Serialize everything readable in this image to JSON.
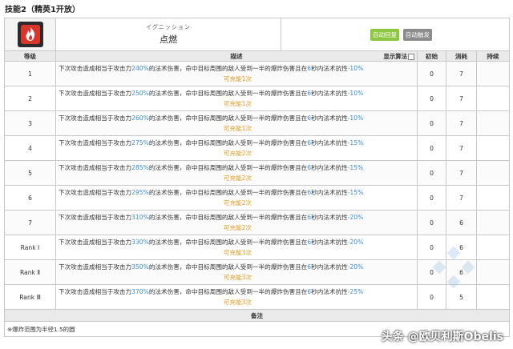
{
  "page": {
    "title": "技能2（精英1开放）"
  },
  "skill": {
    "name_jp": "イグニッション",
    "name_cn": "点燃",
    "icon": "flame-icon",
    "tags": [
      "自动回复",
      "自动触发"
    ],
    "tag_colors": [
      "#8dc63f",
      "#8c8c8c"
    ]
  },
  "columns": {
    "level": "等级",
    "description": "描述",
    "toggle": "显示算法",
    "initial": "初始",
    "cost": "消耗",
    "duration": "持续"
  },
  "levels": [
    {
      "level": "1",
      "pre": "下次攻击造成相当于攻击力",
      "pct": "240%",
      "mid": "的法术伤害，命中目标周围的敌人受到一半的爆炸伤害且在",
      "sec": "6",
      "post": "秒内法术抗性",
      "res": "-10%",
      "charges": "可充能1次",
      "initial": "0",
      "cost": "7",
      "duration": ""
    },
    {
      "level": "2",
      "pre": "下次攻击造成相当于攻击力",
      "pct": "250%",
      "mid": "的法术伤害，命中目标周围的敌人受到一半的爆炸伤害且在",
      "sec": "6",
      "post": "秒内法术抗性",
      "res": "-10%",
      "charges": "可充能1次",
      "initial": "0",
      "cost": "7",
      "duration": ""
    },
    {
      "level": "3",
      "pre": "下次攻击造成相当于攻击力",
      "pct": "260%",
      "mid": "的法术伤害，命中目标周围的敌人受到一半的爆炸伤害且在",
      "sec": "6",
      "post": "秒内法术抗性",
      "res": "-10%",
      "charges": "可充能1次",
      "initial": "0",
      "cost": "7",
      "duration": ""
    },
    {
      "level": "4",
      "pre": "下次攻击造成相当于攻击力",
      "pct": "275%",
      "mid": "的法术伤害，命中目标周围的敌人受到一半的爆炸伤害且在",
      "sec": "6",
      "post": "秒内法术抗性",
      "res": "-15%",
      "charges": "可充能2次",
      "initial": "0",
      "cost": "7",
      "duration": ""
    },
    {
      "level": "5",
      "pre": "下次攻击造成相当于攻击力",
      "pct": "285%",
      "mid": "的法术伤害，命中目标周围的敌人受到一半的爆炸伤害且在",
      "sec": "6",
      "post": "秒内法术抗性",
      "res": "-15%",
      "charges": "可充能2次",
      "initial": "0",
      "cost": "7",
      "duration": ""
    },
    {
      "level": "6",
      "pre": "下次攻击造成相当于攻击力",
      "pct": "295%",
      "mid": "的法术伤害，命中目标周围的敌人受到一半的爆炸伤害且在",
      "sec": "6",
      "post": "秒内法术抗性",
      "res": "-15%",
      "charges": "可充能2次",
      "initial": "0",
      "cost": "7",
      "duration": ""
    },
    {
      "level": "7",
      "pre": "下次攻击造成相当于攻击力",
      "pct": "310%",
      "mid": "的法术伤害，命中目标周围的敌人受到一半的爆炸伤害且在",
      "sec": "6",
      "post": "秒内法术抗性",
      "res": "-20%",
      "charges": "可充能2次",
      "initial": "0",
      "cost": "6",
      "duration": ""
    },
    {
      "level": "Rank Ⅰ",
      "pre": "下次攻击造成相当于攻击力",
      "pct": "330%",
      "mid": "的法术伤害，命中目标周围的敌人受到一半的爆炸伤害且在",
      "sec": "6",
      "post": "秒内法术抗性",
      "res": "-20%",
      "charges": "可充能3次",
      "initial": "0",
      "cost": "6",
      "duration": ""
    },
    {
      "level": "Rank Ⅱ",
      "pre": "下次攻击造成相当于攻击力",
      "pct": "350%",
      "mid": "的法术伤害，命中目标周围的敌人受到一半的爆炸伤害且在",
      "sec": "6",
      "post": "秒内法术抗性",
      "res": "-20%",
      "charges": "可充能3次",
      "initial": "0",
      "cost": "6",
      "duration": ""
    },
    {
      "level": "Rank Ⅲ",
      "pre": "下次攻击造成相当于攻击力",
      "pct": "370%",
      "mid": "的法术伤害，命中目标周围的敌人受到一半的爆炸伤害且在",
      "sec": "6",
      "post": "秒内法术抗性",
      "res": "-25%",
      "charges": "可充能3次",
      "initial": "0",
      "cost": "5",
      "duration": ""
    }
  ],
  "notes": {
    "header": "备注",
    "text": "※爆炸范围为半径1.5的圆"
  },
  "watermark": {
    "text": "头条 @欧贝利斯Obelis"
  }
}
